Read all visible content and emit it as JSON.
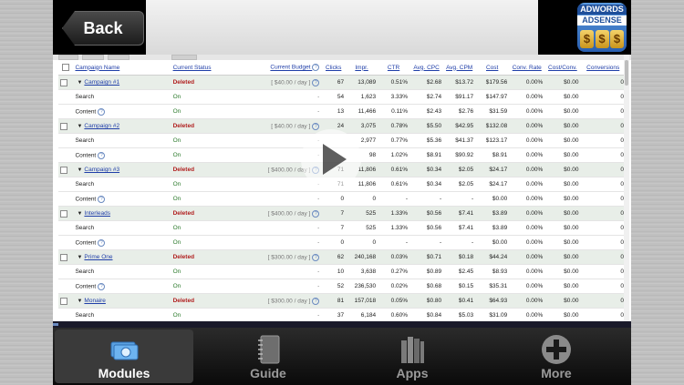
{
  "header": {
    "back_label": "Back",
    "logo_line1": "ADWORDS",
    "logo_line2": "ADSENSE",
    "logo_coin": "$"
  },
  "table": {
    "columns": [
      "Campaign Name",
      "Current Status",
      "Current Budget",
      "Clicks",
      "Impr.",
      "CTR",
      "Avg. CPC",
      "Avg. CPM",
      "Cost",
      "Conv. Rate",
      "Cost/Conv.",
      "Conversions"
    ],
    "rows": [
      {
        "type": "campaign",
        "name": "Campaign #1",
        "status": "Deleted",
        "budget": "[ $40.00 / day ]",
        "clicks": "67",
        "impr": "13,089",
        "ctr": "0.51%",
        "cpc": "$2.68",
        "cpm": "$13.72",
        "cost": "$179.56",
        "conv_rate": "0.00%",
        "cost_conv": "$0.00",
        "conversions": "0"
      },
      {
        "type": "sub",
        "name": "Search",
        "status": "On",
        "budget": "-",
        "clicks": "54",
        "impr": "1,623",
        "ctr": "3.33%",
        "cpc": "$2.74",
        "cpm": "$91.17",
        "cost": "$147.97",
        "conv_rate": "0.00%",
        "cost_conv": "$0.00",
        "conversions": "0"
      },
      {
        "type": "sub",
        "name": "Content",
        "status": "On",
        "budget": "-",
        "clicks": "13",
        "impr": "11,466",
        "ctr": "0.11%",
        "cpc": "$2.43",
        "cpm": "$2.76",
        "cost": "$31.59",
        "conv_rate": "0.00%",
        "cost_conv": "$0.00",
        "conversions": "0"
      },
      {
        "type": "campaign",
        "name": "Campaign #2",
        "status": "Deleted",
        "budget": "[ $40.00 / day ]",
        "clicks": "24",
        "impr": "3,075",
        "ctr": "0.78%",
        "cpc": "$5.50",
        "cpm": "$42.95",
        "cost": "$132.08",
        "conv_rate": "0.00%",
        "cost_conv": "$0.00",
        "conversions": "0"
      },
      {
        "type": "sub",
        "name": "Search",
        "status": "On",
        "budget": "-",
        "clicks": "",
        "impr": "2,977",
        "ctr": "0.77%",
        "cpc": "$5.36",
        "cpm": "$41.37",
        "cost": "$123.17",
        "conv_rate": "0.00%",
        "cost_conv": "$0.00",
        "conversions": "0"
      },
      {
        "type": "sub",
        "name": "Content",
        "status": "On",
        "budget": "-",
        "clicks": "",
        "impr": "98",
        "ctr": "1.02%",
        "cpc": "$8.91",
        "cpm": "$90.92",
        "cost": "$8.91",
        "conv_rate": "0.00%",
        "cost_conv": "$0.00",
        "conversions": "0"
      },
      {
        "type": "campaign",
        "name": "Campaign #3",
        "status": "Deleted",
        "budget": "[ $400.00 / day ]",
        "clicks": "71",
        "impr": "11,806",
        "ctr": "0.61%",
        "cpc": "$0.34",
        "cpm": "$2.05",
        "cost": "$24.17",
        "conv_rate": "0.00%",
        "cost_conv": "$0.00",
        "conversions": "0"
      },
      {
        "type": "sub",
        "name": "Search",
        "status": "On",
        "budget": "-",
        "clicks": "71",
        "impr": "11,806",
        "ctr": "0.61%",
        "cpc": "$0.34",
        "cpm": "$2.05",
        "cost": "$24.17",
        "conv_rate": "0.00%",
        "cost_conv": "$0.00",
        "conversions": "0"
      },
      {
        "type": "sub",
        "name": "Content",
        "status": "On",
        "budget": "-",
        "clicks": "0",
        "impr": "0",
        "ctr": "-",
        "cpc": "-",
        "cpm": "-",
        "cost": "$0.00",
        "conv_rate": "0.00%",
        "cost_conv": "$0.00",
        "conversions": "0"
      },
      {
        "type": "campaign",
        "name": "Interleads",
        "status": "Deleted",
        "budget": "[ $400.00 / day ]",
        "clicks": "7",
        "impr": "525",
        "ctr": "1.33%",
        "cpc": "$0.56",
        "cpm": "$7.41",
        "cost": "$3.89",
        "conv_rate": "0.00%",
        "cost_conv": "$0.00",
        "conversions": "0"
      },
      {
        "type": "sub",
        "name": "Search",
        "status": "On",
        "budget": "-",
        "clicks": "7",
        "impr": "525",
        "ctr": "1.33%",
        "cpc": "$0.56",
        "cpm": "$7.41",
        "cost": "$3.89",
        "conv_rate": "0.00%",
        "cost_conv": "$0.00",
        "conversions": "0"
      },
      {
        "type": "sub",
        "name": "Content",
        "status": "On",
        "budget": "-",
        "clicks": "0",
        "impr": "0",
        "ctr": "-",
        "cpc": "-",
        "cpm": "-",
        "cost": "$0.00",
        "conv_rate": "0.00%",
        "cost_conv": "$0.00",
        "conversions": "0"
      },
      {
        "type": "campaign",
        "name": "Prime One",
        "status": "Deleted",
        "budget": "[ $300.00 / day ]",
        "clicks": "62",
        "impr": "240,168",
        "ctr": "0.03%",
        "cpc": "$0.71",
        "cpm": "$0.18",
        "cost": "$44.24",
        "conv_rate": "0.00%",
        "cost_conv": "$0.00",
        "conversions": "0"
      },
      {
        "type": "sub",
        "name": "Search",
        "status": "On",
        "budget": "-",
        "clicks": "10",
        "impr": "3,638",
        "ctr": "0.27%",
        "cpc": "$0.89",
        "cpm": "$2.45",
        "cost": "$8.93",
        "conv_rate": "0.00%",
        "cost_conv": "$0.00",
        "conversions": "0"
      },
      {
        "type": "sub",
        "name": "Content",
        "status": "On",
        "budget": "-",
        "clicks": "52",
        "impr": "236,530",
        "ctr": "0.02%",
        "cpc": "$0.68",
        "cpm": "$0.15",
        "cost": "$35.31",
        "conv_rate": "0.00%",
        "cost_conv": "$0.00",
        "conversions": "0"
      },
      {
        "type": "campaign",
        "name": "Monaire",
        "status": "Deleted",
        "budget": "[ $300.00 / day ]",
        "clicks": "81",
        "impr": "157,018",
        "ctr": "0.05%",
        "cpc": "$0.80",
        "cpm": "$0.41",
        "cost": "$64.93",
        "conv_rate": "0.00%",
        "cost_conv": "$0.00",
        "conversions": "0"
      },
      {
        "type": "sub",
        "name": "Search",
        "status": "On",
        "budget": "-",
        "clicks": "37",
        "impr": "6,184",
        "ctr": "0.60%",
        "cpc": "$0.84",
        "cpm": "$5.03",
        "cost": "$31.09",
        "conv_rate": "0.00%",
        "cost_conv": "$0.00",
        "conversions": "0"
      }
    ]
  },
  "tabs": [
    {
      "label": "Modules",
      "icon": "money-icon",
      "active": true
    },
    {
      "label": "Guide",
      "icon": "notebook-icon",
      "active": false
    },
    {
      "label": "Apps",
      "icon": "books-icon",
      "active": false
    },
    {
      "label": "More",
      "icon": "plus-icon",
      "active": false
    }
  ]
}
